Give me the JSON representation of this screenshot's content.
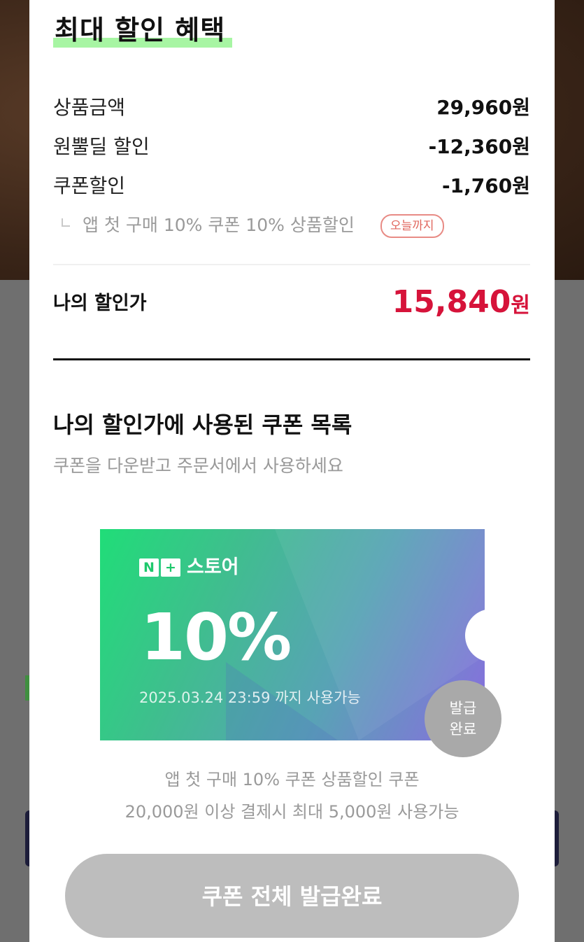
{
  "benefit": {
    "title": "최대 할인 혜택",
    "rows": [
      {
        "label": "상품금액",
        "value": "29,960원"
      },
      {
        "label": "원뿔딜 할인",
        "value": "-12,360원"
      },
      {
        "label": "쿠폰할인",
        "value": "-1,760원"
      }
    ],
    "coupon_detail": "앱 첫 구매 10% 쿠폰 10% 상품할인",
    "coupon_badge": "오늘까지",
    "my_price_label": "나의 할인가",
    "my_price_value": "15,840",
    "my_price_unit": "원"
  },
  "coupon_list": {
    "title": "나의 할인가에 사용된 쿠폰 목록",
    "subtitle": "쿠폰을 다운받고 주문서에서 사용하세요"
  },
  "coupon": {
    "brand_n": "N",
    "brand_plus": "+",
    "brand_store": "스토어",
    "discount": "10%",
    "expiry": "2025.03.24 23:59 까지 사용가능",
    "status_line1": "발급",
    "status_line2": "완료",
    "desc_line1": "앱 첫 구매 10% 쿠폰 상품할인 쿠폰",
    "desc_line2": "20,000원 이상 결제시 최대 5,000원 사용가능",
    "accent_color": "#1ec86c"
  },
  "cta": {
    "label": "쿠폰 전체 발급완료"
  }
}
